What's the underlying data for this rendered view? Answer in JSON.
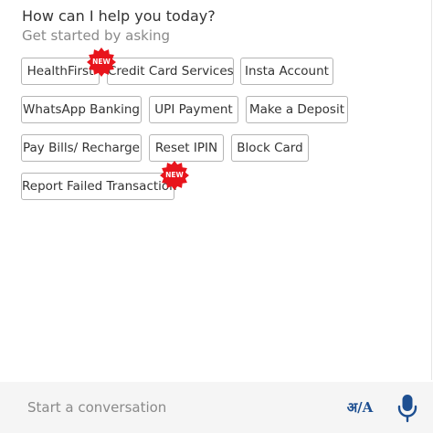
{
  "greeting": "How can I help you today?",
  "subtitle": "Get started by asking",
  "chips": [
    {
      "label": "HealthFirst"
    },
    {
      "label": "Credit Card Services"
    },
    {
      "label": "Insta Account"
    },
    {
      "label": "WhatsApp Banking"
    },
    {
      "label": "UPI Payment"
    },
    {
      "label": "Make a Deposit"
    },
    {
      "label": "Pay Bills/ Recharge"
    },
    {
      "label": "Reset IPIN"
    },
    {
      "label": "Block Card"
    },
    {
      "label": "Report Failed Transaction"
    }
  ],
  "badge_text": "NEW",
  "input": {
    "placeholder": "Start a conversation"
  },
  "lang_toggle": "अ/A",
  "colors": {
    "badge": "#e8141c",
    "mic": "#1d4f91",
    "chip_border": "#b5b5b5"
  },
  "icons": {
    "mic": "microphone-icon",
    "badge": "new-badge-icon"
  }
}
